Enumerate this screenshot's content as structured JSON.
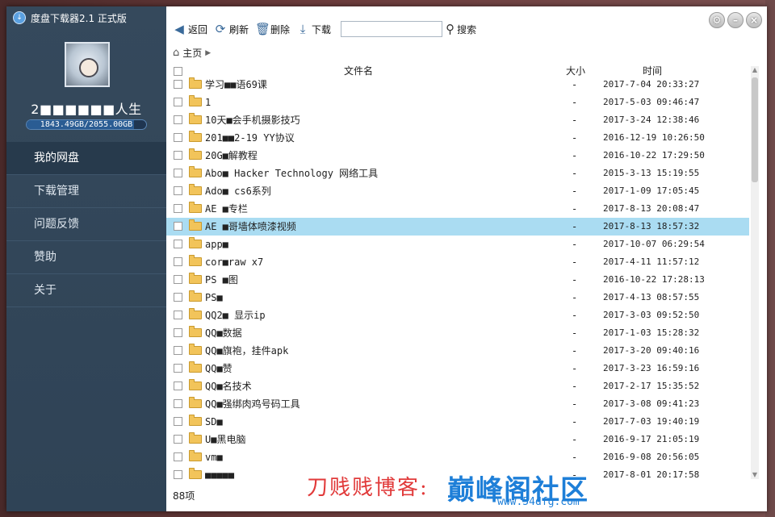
{
  "app": {
    "title": "度盘下载器2.1 正式版"
  },
  "user": {
    "name": "2■■■■■■人生",
    "quota_text": "1843.49GB/2055.00GB",
    "quota_fraction": 0.897
  },
  "sidebar": {
    "items": [
      {
        "label": "我的网盘",
        "active": true
      },
      {
        "label": "下载管理",
        "active": false
      },
      {
        "label": "问题反馈",
        "active": false
      },
      {
        "label": "赞助",
        "active": false
      },
      {
        "label": "关于",
        "active": false
      }
    ]
  },
  "toolbar": {
    "back_label": "返回",
    "refresh_label": "刷新",
    "delete_label": "删除",
    "download_label": "下载",
    "search_value": "",
    "search_label": "搜索"
  },
  "breadcrumb": {
    "home_label": "主页"
  },
  "table": {
    "headers": {
      "name": "文件名",
      "size": "大小",
      "time": "时间"
    },
    "rows": [
      {
        "name": "学习■■语69课",
        "size": "-",
        "time": "2017-7-04 20:33:27"
      },
      {
        "name": "1",
        "size": "-",
        "time": "2017-5-03 09:46:47"
      },
      {
        "name": "10天■会手机摄影技巧",
        "size": "-",
        "time": "2017-3-24 12:38:46"
      },
      {
        "name": "201■■2-19 YY协议",
        "size": "-",
        "time": "2016-12-19 10:26:50"
      },
      {
        "name": "20G■解教程",
        "size": "-",
        "time": "2016-10-22 17:29:50"
      },
      {
        "name": "Abo■ Hacker Technology 网络工具",
        "size": "-",
        "time": "2015-3-13 15:19:55"
      },
      {
        "name": "Ado■ cs6系列",
        "size": "-",
        "time": "2017-1-09 17:05:45"
      },
      {
        "name": "AE ■专栏",
        "size": "-",
        "time": "2017-8-13 20:08:47"
      },
      {
        "name": "AE ■哥墙体喷漆视频",
        "size": "-",
        "time": "2017-8-13 18:57:32",
        "selected": true
      },
      {
        "name": "app■",
        "size": "-",
        "time": "2017-10-07 06:29:54"
      },
      {
        "name": "cor■raw x7",
        "size": "-",
        "time": "2017-4-11 11:57:12"
      },
      {
        "name": "PS ■图",
        "size": "-",
        "time": "2016-10-22 17:28:13"
      },
      {
        "name": "PS■",
        "size": "-",
        "time": "2017-4-13 08:57:55"
      },
      {
        "name": "QQ2■ 显示ip",
        "size": "-",
        "time": "2017-3-03 09:52:50"
      },
      {
        "name": "QQ■数据",
        "size": "-",
        "time": "2017-1-03 15:28:32"
      },
      {
        "name": "QQ■旗袍，挂件apk",
        "size": "-",
        "time": "2017-3-20 09:40:16"
      },
      {
        "name": "QQ■赞",
        "size": "-",
        "time": "2017-3-23 16:59:16"
      },
      {
        "name": "QQ■名技术",
        "size": "-",
        "time": "2017-2-17 15:35:52"
      },
      {
        "name": "QQ■强绑肉鸡号码工具",
        "size": "-",
        "time": "2017-3-08 09:41:23"
      },
      {
        "name": "SD■",
        "size": "-",
        "time": "2017-7-03 19:40:19"
      },
      {
        "name": "U■黑电脑",
        "size": "-",
        "time": "2016-9-17 21:05:19"
      },
      {
        "name": "vm■",
        "size": "-",
        "time": "2016-9-08 20:56:05"
      },
      {
        "name": "■■■■■",
        "size": "-",
        "time": "2017-8-01 20:17:58"
      }
    ]
  },
  "footer": {
    "count_label": "88项"
  },
  "watermark": {
    "blog_text": "刀贱贱博客:",
    "logo_text": "巅峰阁社区",
    "url_text": "www.54dfg.com"
  },
  "colors": {
    "sidebar_bg": "#35495c",
    "selected_row": "#aadcf2",
    "accent": "#1e7fd8"
  }
}
